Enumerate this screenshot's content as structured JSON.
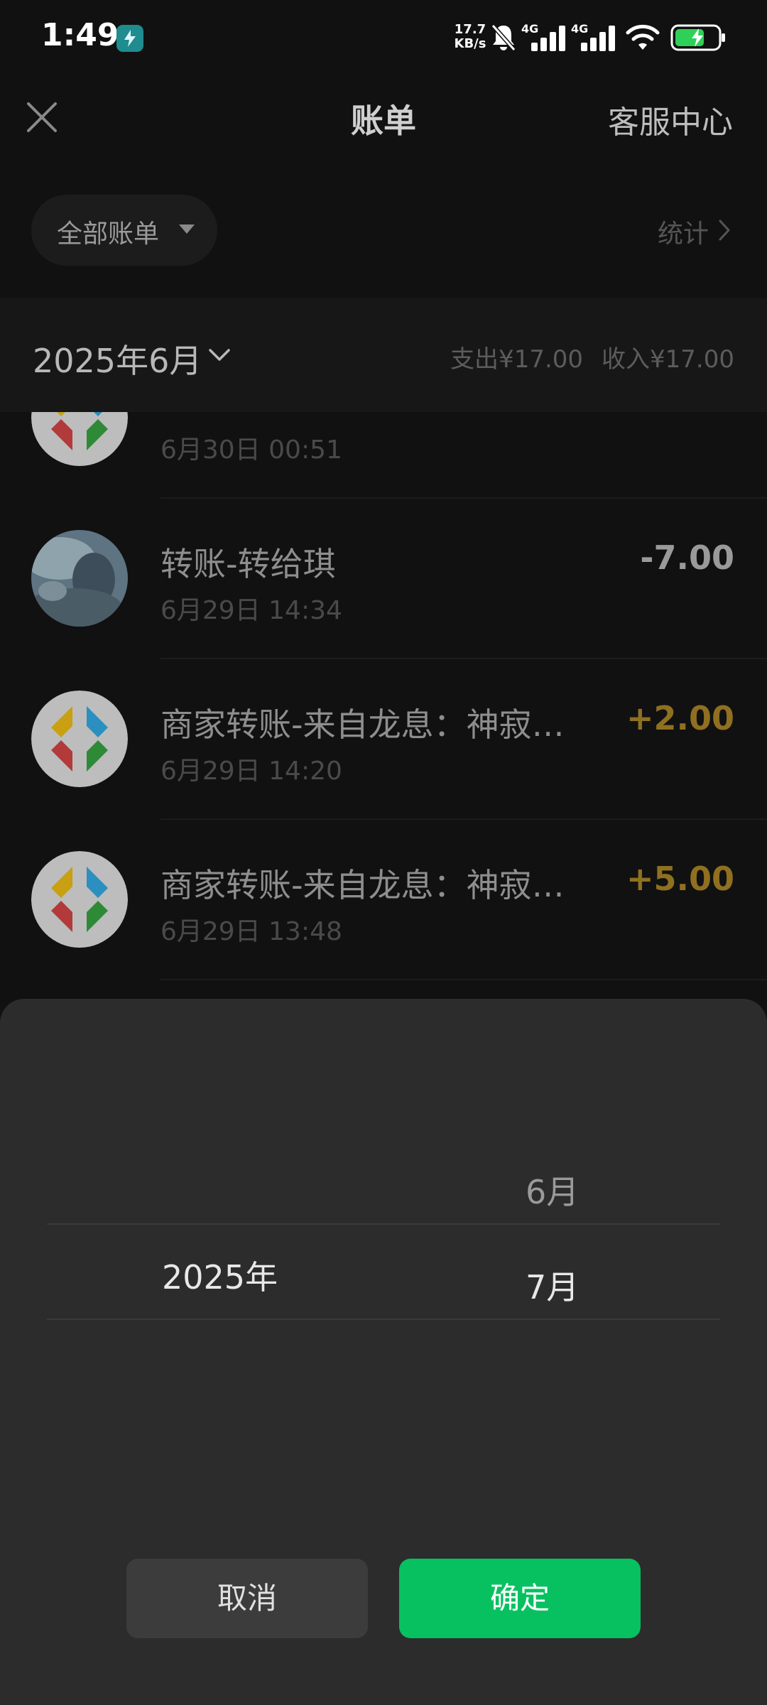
{
  "status_bar": {
    "time": "1:49",
    "net_speed_value": "17.7",
    "net_speed_unit": "KB/s",
    "network_labels": [
      "4G",
      "4G"
    ],
    "icons": [
      "app-icon",
      "mute-bell-icon",
      "signal-icon",
      "signal-icon",
      "wifi-icon",
      "battery-charging-icon"
    ]
  },
  "header": {
    "title": "账单",
    "close_icon": "close-icon",
    "service_link": "客服中心"
  },
  "filter": {
    "selected": "全部账单",
    "stats_link": "统计"
  },
  "month_bar": {
    "month": "2025年6月",
    "expense": "支出¥17.00",
    "income": "收入¥17.00"
  },
  "transactions": [
    {
      "title": "",
      "time": "6月30日 00:51",
      "amount": "",
      "avatar": "merchant-logo"
    },
    {
      "title": "转账-转给琪",
      "time": "6月29日 14:34",
      "amount": "-7.00",
      "avatar": "photo"
    },
    {
      "title": "商家转账-来自龙息：神寂…",
      "time": "6月29日 14:20",
      "amount": "+2.00",
      "avatar": "merchant-logo"
    },
    {
      "title": "商家转账-来自龙息：神寂…",
      "time": "6月29日 13:48",
      "amount": "+5.00",
      "avatar": "merchant-logo"
    }
  ],
  "picker": {
    "year": "2025年",
    "months": [
      "6月",
      "7月"
    ],
    "selected_month": "7月",
    "cancel_label": "取消",
    "confirm_label": "确定"
  },
  "colors": {
    "accent_green": "#07c160",
    "income_gold": "#8f7020",
    "sheet_bg": "#2c2c2c"
  }
}
